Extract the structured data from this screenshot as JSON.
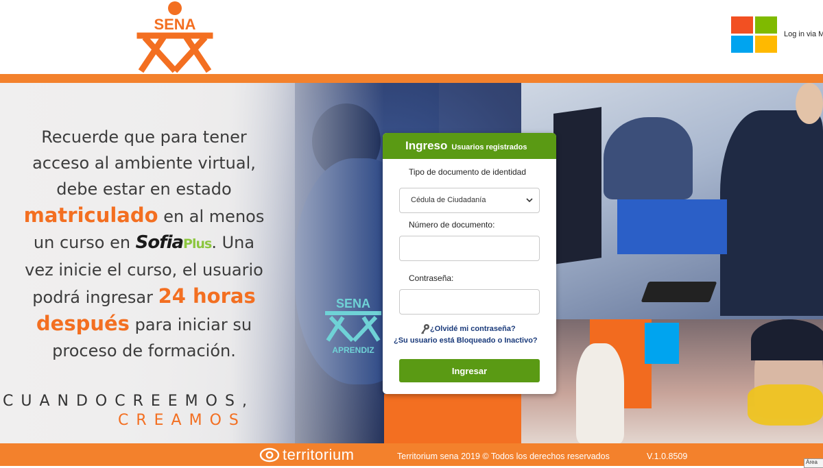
{
  "header": {
    "logo_text": "SENA",
    "microsoft_login_label": "Log in via M",
    "colors": {
      "orange": "#f3812c",
      "ms_red": "#f25022",
      "ms_green": "#7fba00",
      "ms_blue": "#00a4ef",
      "ms_yellow": "#ffb900"
    }
  },
  "hero": {
    "message": {
      "line1": "Recuerde que para tener",
      "line2": "acceso al ambiente virtual,",
      "line3": "debe estar en estado",
      "highlight1": "matriculado",
      "line4_rest": " en al menos",
      "line5_pre": "un curso en ",
      "sofia": "Sofia",
      "plus": "Plus",
      "line5_post": ". Una",
      "line6": "vez inicie el curso, el usuario",
      "line7_pre": "podrá ingresar ",
      "highlight2": "24 horas",
      "highlight3": "después",
      "line8_rest": " para iniciar su",
      "line9": "proceso de formación."
    },
    "slogan_line1": "CUANDOCREEMOS,",
    "slogan_line2": "CREAMOS",
    "watermark_text": "SENA",
    "watermark_sub": "APRENDIZ"
  },
  "login": {
    "title": "Ingreso",
    "subtitle": "Usuarios registrados",
    "doc_type_label": "Tipo de documento de identidad",
    "doc_type_value": "Cédula de Ciudadanía",
    "doc_number_label": "Número de documento:",
    "doc_number_value": "",
    "password_label": "Contraseña:",
    "password_value": "",
    "forgot_password": "¿Olvidé mi contraseña?",
    "blocked_user": "¿Su usuario está Bloqueado o Inactivo?",
    "submit_label": "Ingresar",
    "accent_color": "#5a9a14"
  },
  "footer": {
    "brand": "territorium",
    "copyright": "Territorium sena 2019 © Todos los derechos reservados",
    "version": "V.1.0.8509",
    "corner_tag": "Área"
  }
}
